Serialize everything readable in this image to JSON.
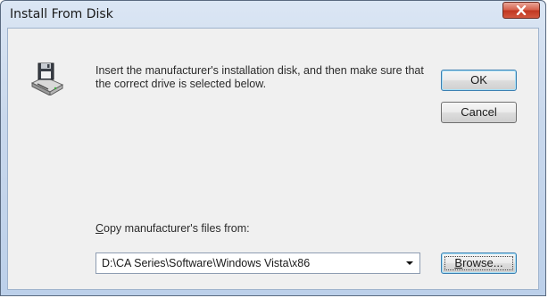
{
  "window": {
    "title": "Install From Disk",
    "close_icon": "close-icon"
  },
  "message": {
    "icon": "floppy-disk-icon",
    "text": "Insert the manufacturer's installation disk, and then make sure that the correct drive is selected below."
  },
  "buttons": {
    "ok_label": "OK",
    "cancel_label": "Cancel",
    "browse_label_prefix": "B",
    "browse_label_rest": "rowse..."
  },
  "copy_from": {
    "label_accel": "C",
    "label_rest": "opy manufacturer's files from:",
    "value": "D:\\CA Series\\Software\\Windows Vista\\x86"
  },
  "colors": {
    "close_button": "#d2573f",
    "focus_border": "#3c7fb1",
    "client_bg": "#f0f0f0"
  }
}
